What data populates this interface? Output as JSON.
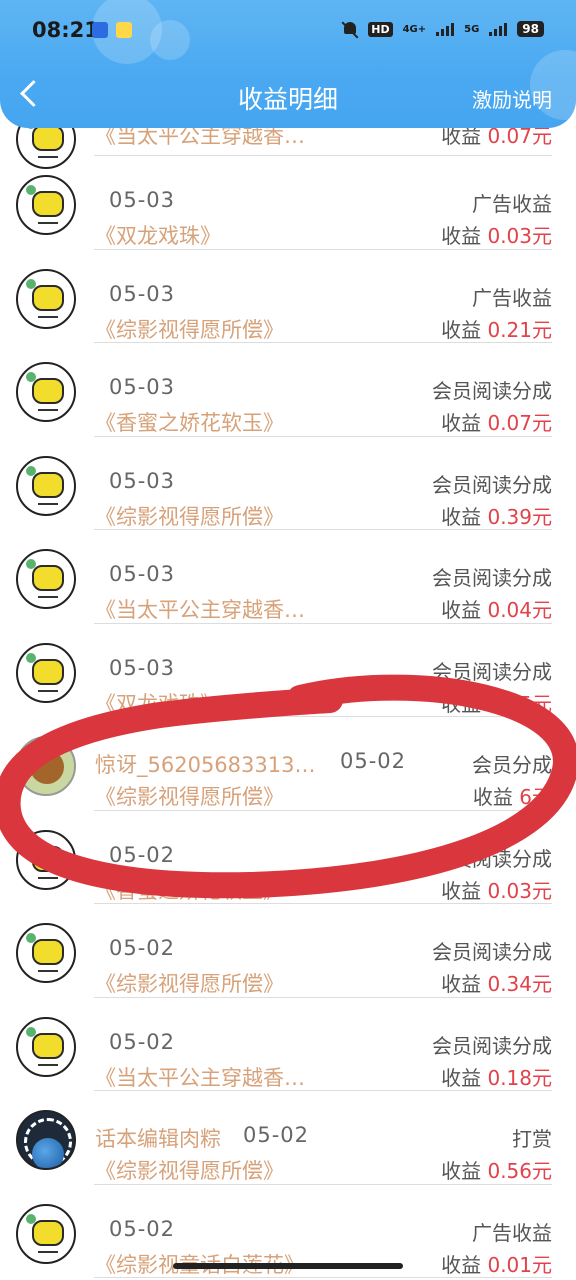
{
  "status_bar": {
    "time": "08:21",
    "network": "HD",
    "net_type_1": "4G+",
    "net_type_2": "5G",
    "battery": "98"
  },
  "nav": {
    "title": "收益明细",
    "right_link": "激励说明"
  },
  "currency_suffix": "元",
  "amount_label": "收益",
  "colors": {
    "header": "#4aa9f1",
    "amount": "#e2424a",
    "book": "#d7a27a",
    "marker": "#d9373d"
  },
  "rows": [
    {
      "date": "",
      "user": "",
      "book": "《当太平公主穿越香…",
      "type": "",
      "amount_label": "收益",
      "amount": "0.07元",
      "avatar": "yellow-chat-avatar"
    },
    {
      "date": "05-03",
      "user": "",
      "book": "《双龙戏珠》",
      "type": "广告收益",
      "amount_label": "收益",
      "amount": "0.03元",
      "avatar": "yellow-chat-avatar"
    },
    {
      "date": "05-03",
      "user": "",
      "book": "《综影视得愿所偿》",
      "type": "广告收益",
      "amount_label": "收益",
      "amount": "0.21元",
      "avatar": "yellow-chat-avatar"
    },
    {
      "date": "05-03",
      "user": "",
      "book": "《香蜜之娇花软玉》",
      "type": "会员阅读分成",
      "amount_label": "收益",
      "amount": "0.07元",
      "avatar": "yellow-chat-avatar"
    },
    {
      "date": "05-03",
      "user": "",
      "book": "《综影视得愿所偿》",
      "type": "会员阅读分成",
      "amount_label": "收益",
      "amount": "0.39元",
      "avatar": "yellow-chat-avatar"
    },
    {
      "date": "05-03",
      "user": "",
      "book": "《当太平公主穿越香…",
      "type": "会员阅读分成",
      "amount_label": "收益",
      "amount": "0.04元",
      "avatar": "yellow-chat-avatar"
    },
    {
      "date": "05-03",
      "user": "",
      "book": "《双龙戏珠》",
      "type": "会员阅读分成",
      "amount_label": "收益",
      "amount": "0.05元",
      "avatar": "yellow-chat-avatar"
    },
    {
      "date": "05-02",
      "user": "惊讶_56205683313…",
      "book": "《综影视得愿所偿》",
      "type": "会员分成",
      "amount_label": "收益",
      "amount": "6元",
      "avatar": "bear-avatar"
    },
    {
      "date": "05-02",
      "user": "",
      "book": "《香蜜之娇花软玉》",
      "type": "会员阅读分成",
      "amount_label": "收益",
      "amount": "0.03元",
      "avatar": "yellow-chat-avatar"
    },
    {
      "date": "05-02",
      "user": "",
      "book": "《综影视得愿所偿》",
      "type": "会员阅读分成",
      "amount_label": "收益",
      "amount": "0.34元",
      "avatar": "yellow-chat-avatar"
    },
    {
      "date": "05-02",
      "user": "",
      "book": "《当太平公主穿越香…",
      "type": "会员阅读分成",
      "amount_label": "收益",
      "amount": "0.18元",
      "avatar": "yellow-chat-avatar"
    },
    {
      "date": "05-02",
      "user": "话本编辑肉粽",
      "book": "《综影视得愿所偿》",
      "type": "打赏",
      "amount_label": "收益",
      "amount": "0.56元",
      "avatar": "globe-avatar"
    },
    {
      "date": "05-02",
      "user": "",
      "book": "《综影视童话白莲花》",
      "type": "广告收益",
      "amount_label": "收益",
      "amount": "0.01元",
      "avatar": "yellow-chat-avatar"
    }
  ]
}
